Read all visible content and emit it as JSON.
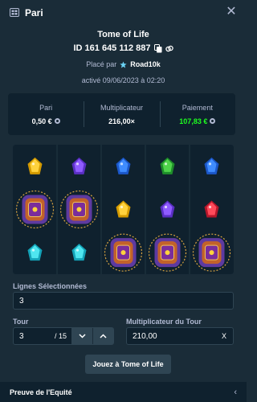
{
  "header": {
    "title": "Pari",
    "close_symbol": "✕"
  },
  "game": {
    "name": "Tome of Life",
    "bet_id": "ID 161 645 112 887",
    "placed_prefix": "Placé par",
    "user": "Road10k",
    "activated": "activé 09/06/2023 à 02:20"
  },
  "stats": {
    "bet_label": "Pari",
    "bet_value": "0,50 €",
    "multiplier_label": "Multiplicateur",
    "multiplier_value": "216,00×",
    "payout_label": "Paiement",
    "payout_value": "107,83 €"
  },
  "board": {
    "columns": 5,
    "symbols": [
      [
        "yellow-gem",
        "purple-gem",
        "blue-gem",
        "green-gem",
        "blue-gem"
      ],
      [
        "tome-wild",
        "tome-wild",
        "yellow-gem",
        "purple-gem",
        "red-gem"
      ],
      [
        "cyan-gem",
        "cyan-gem",
        "tome-wild",
        "tome-wild",
        "tome-wild"
      ]
    ]
  },
  "form": {
    "lines_label": "Lignes Sélectionnées",
    "lines_value": "3",
    "tour_label": "Tour",
    "tour_value": "3",
    "tour_total": "/ 15",
    "tour_multiplier_label": "Multiplicateur du Tour",
    "tour_multiplier_value": "210,00",
    "tour_multiplier_suffix": "X",
    "play_button": "Jouez à Tome of Life"
  },
  "footer": {
    "label": "Preuve de l'Equité",
    "chevron": "‹"
  },
  "colors": {
    "background": "#1a2c38",
    "panel": "#0f212e",
    "border": "#2f4553",
    "muted_text": "#b1bad3",
    "win_green": "#1fff20",
    "tome_orange": "#c2622a",
    "tome_purple": "#5e3aa0"
  }
}
